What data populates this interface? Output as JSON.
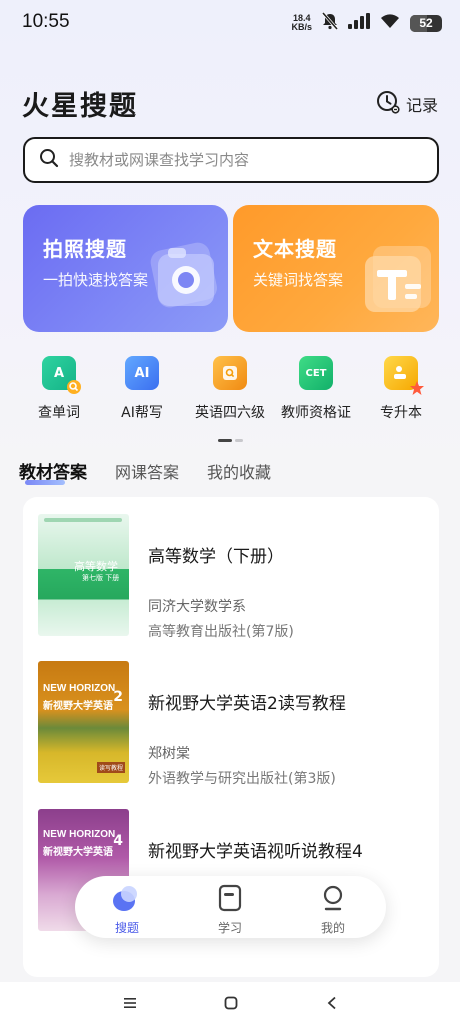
{
  "status": {
    "time": "10:55",
    "speed_value": "18.4",
    "speed_unit": "KB/s",
    "battery": "52"
  },
  "header": {
    "title": "火星搜题",
    "records_label": "记录"
  },
  "search": {
    "placeholder": "搜教材或网课查找学习内容"
  },
  "cards": {
    "photo": {
      "title": "拍照搜题",
      "subtitle": "一拍快速找答案"
    },
    "text": {
      "title": "文本搜题",
      "subtitle": "关键词找答案"
    }
  },
  "tools": [
    {
      "label": "查单词",
      "icon": "word-lookup-icon",
      "color": "#1fbf8f"
    },
    {
      "label": "AI帮写",
      "icon": "ai-write-icon",
      "color": "#3b82f6"
    },
    {
      "label": "英语四六级",
      "icon": "cet-book-icon",
      "color": "#f59e0b"
    },
    {
      "label": "教师资格证",
      "icon": "certificate-icon",
      "color": "#22c55e"
    },
    {
      "label": "专升本",
      "icon": "upgrade-icon",
      "color": "#f6b300"
    }
  ],
  "tool_icon_texts": {
    "ai": "AI",
    "cet": "CET",
    "word": "A"
  },
  "tabs": [
    {
      "label": "教材答案",
      "active": true
    },
    {
      "label": "网课答案",
      "active": false
    },
    {
      "label": "我的收藏",
      "active": false
    }
  ],
  "books": [
    {
      "title": "高等数学（下册）",
      "author": "同济大学数学系",
      "publisher": "高等教育出版社(第7版)",
      "cover_title": "高等数学",
      "cover_sub": "第七版  下册"
    },
    {
      "title": "新视野大学英语2读写教程",
      "author": "郑树棠",
      "publisher": "外语教学与研究出版社(第3版)",
      "cover_brand": "NEW HORIZON",
      "cover_title": "新视野大学英语",
      "cover_num": "2",
      "cover_tag": "读写教程"
    },
    {
      "title": "新视野大学英语视听说教程4",
      "cover_brand": "NEW HORIZON",
      "cover_title": "新视野大学英语",
      "cover_num": "4"
    }
  ],
  "bottom_nav": [
    {
      "label": "搜题",
      "active": true
    },
    {
      "label": "学习",
      "active": false
    },
    {
      "label": "我的",
      "active": false
    }
  ],
  "colors": {
    "accent": "#4a5ae8",
    "photo_card": "#6b6cf2",
    "text_card": "#ff9a2a"
  }
}
